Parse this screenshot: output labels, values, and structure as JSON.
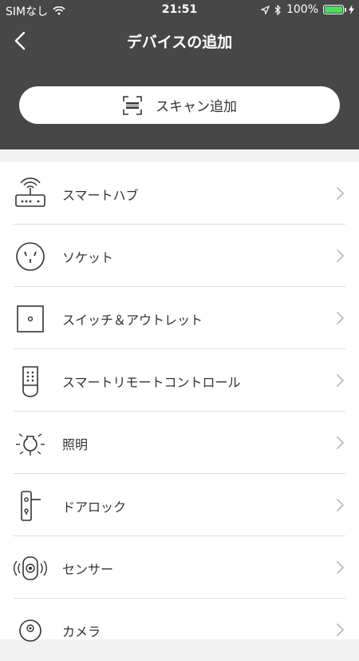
{
  "status_bar": {
    "carrier": "SIMなし",
    "time": "21:51",
    "battery_percent": "100%",
    "battery_level": 1.0,
    "icons": [
      "wifi-icon",
      "location-arrow-icon",
      "bluetooth-icon",
      "battery-icon",
      "charging-bolt-icon"
    ]
  },
  "nav": {
    "title": "デバイスの追加",
    "back_icon": "chevron-left-icon"
  },
  "scan": {
    "label": "スキャン追加",
    "icon": "scan-frame-icon"
  },
  "categories": [
    {
      "label": "スマートハブ",
      "icon": "router-icon"
    },
    {
      "label": "ソケット",
      "icon": "socket-icon"
    },
    {
      "label": "スイッチ＆アウトレット",
      "icon": "switch-icon"
    },
    {
      "label": "スマートリモートコントロール",
      "icon": "remote-control-icon"
    },
    {
      "label": "照明",
      "icon": "lightbulb-icon"
    },
    {
      "label": "ドアロック",
      "icon": "door-lock-icon"
    },
    {
      "label": "センサー",
      "icon": "sensor-icon"
    },
    {
      "label": "カメラ",
      "icon": "camera-icon"
    }
  ],
  "colors": {
    "header_bg": "#474747",
    "battery_fill": "#4cd964",
    "list_bg": "#ffffff",
    "page_bg": "#f2f2f2"
  }
}
